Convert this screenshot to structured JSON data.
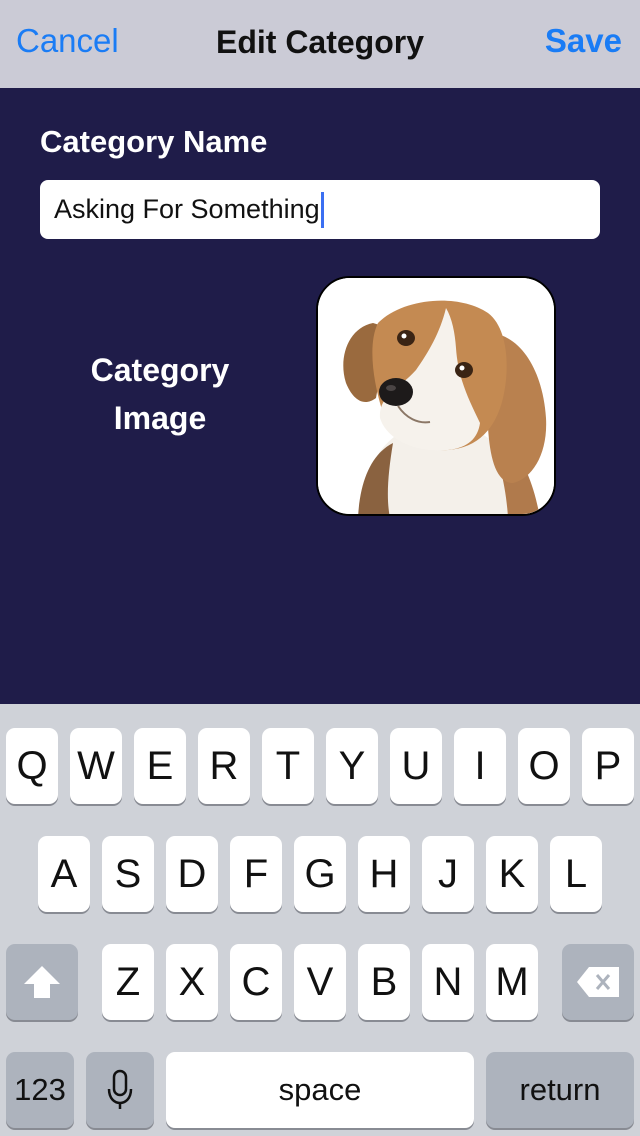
{
  "nav": {
    "cancel_label": "Cancel",
    "title": "Edit Category",
    "save_label": "Save"
  },
  "form": {
    "name_label": "Category Name",
    "name_value": "Asking For Something",
    "image_label_line1": "Category",
    "image_label_line2": "Image"
  },
  "keyboard": {
    "row1": [
      "Q",
      "W",
      "E",
      "R",
      "T",
      "Y",
      "U",
      "I",
      "O",
      "P"
    ],
    "row2": [
      "A",
      "S",
      "D",
      "F",
      "G",
      "H",
      "J",
      "K",
      "L"
    ],
    "row3": [
      "Z",
      "X",
      "C",
      "V",
      "B",
      "N",
      "M"
    ],
    "numbers_label": "123",
    "space_label": "space",
    "return_label": "return",
    "shift_icon": "shift-arrow-icon",
    "delete_icon": "backspace-icon",
    "mic_icon": "microphone-icon"
  },
  "colors": {
    "accent": "#1a7cf5",
    "background": "#1f1c49",
    "nav_bar": "#cbcbd6",
    "keyboard": "#cfd2d8"
  }
}
